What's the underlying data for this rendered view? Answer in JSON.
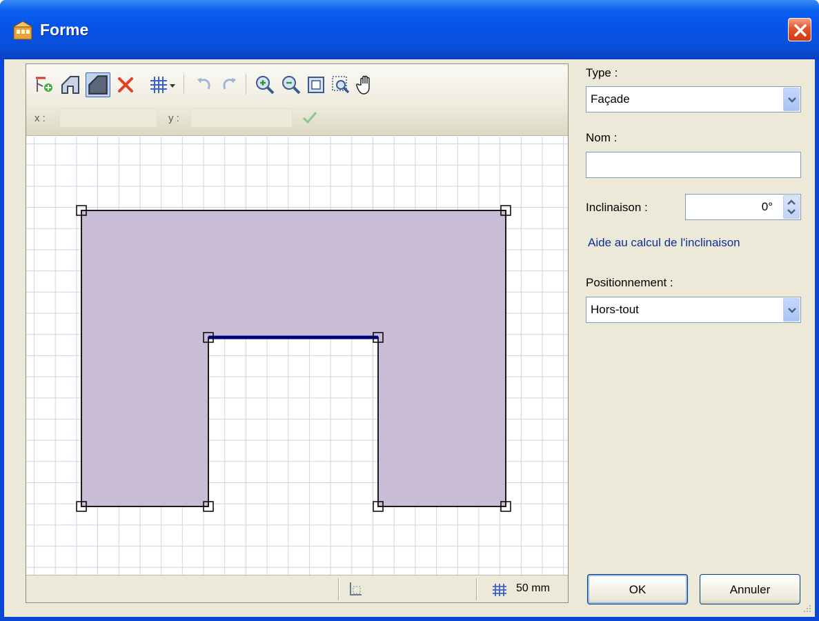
{
  "window": {
    "title": "Forme",
    "close_icon": "close-icon"
  },
  "toolbar": {
    "icons": [
      "add-point-icon",
      "shape-outline-icon",
      "shape-fill-icon",
      "delete-icon",
      "grid-icon",
      "dropdown-arrow-icon",
      "undo-icon",
      "redo-icon",
      "zoom-in-icon",
      "zoom-out-icon",
      "zoom-fit-icon",
      "zoom-selection-icon",
      "pan-hand-icon"
    ],
    "x_label": "x :",
    "y_label": "y :",
    "x_value": "",
    "y_value": ""
  },
  "status": {
    "grid_size": "50 mm"
  },
  "form": {
    "type_label": "Type :",
    "type_value": "Façade",
    "name_label": "Nom :",
    "name_value": "",
    "inclinaison_label": "Inclinaison :",
    "inclinaison_value": "0°",
    "help_link": "Aide au calcul de l'inclinaison",
    "position_label": "Positionnement :",
    "position_value": "Hors-tout"
  },
  "buttons": {
    "ok": "OK",
    "cancel": "Annuler"
  },
  "colors": {
    "shape_fill": "#c8bcd6",
    "selected_edge": "#000080",
    "titlebar": "#0a5ff0"
  }
}
